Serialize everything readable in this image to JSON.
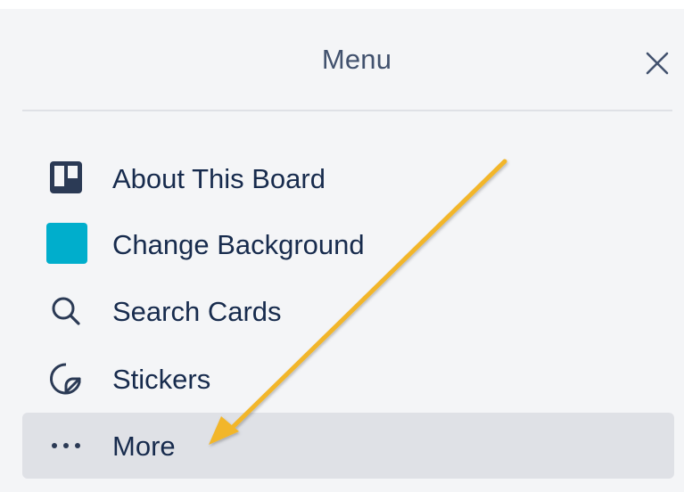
{
  "menu": {
    "title": "Menu",
    "close_icon": "close-icon"
  },
  "items": [
    {
      "label": "About This Board",
      "icon": "board-icon"
    },
    {
      "label": "Change Background",
      "icon": "background-swatch",
      "swatch_color": "#00aecc"
    },
    {
      "label": "Search Cards",
      "icon": "search-icon"
    },
    {
      "label": "Stickers",
      "icon": "sticker-icon"
    },
    {
      "label": "More",
      "icon": "more-icon",
      "highlighted": true
    }
  ],
  "colors": {
    "panel_bg": "#f4f5f7",
    "highlight_bg": "#dfe1e6",
    "text": "#172b4d",
    "title_text": "#42526e",
    "annotation_arrow": "#f2b62a"
  }
}
